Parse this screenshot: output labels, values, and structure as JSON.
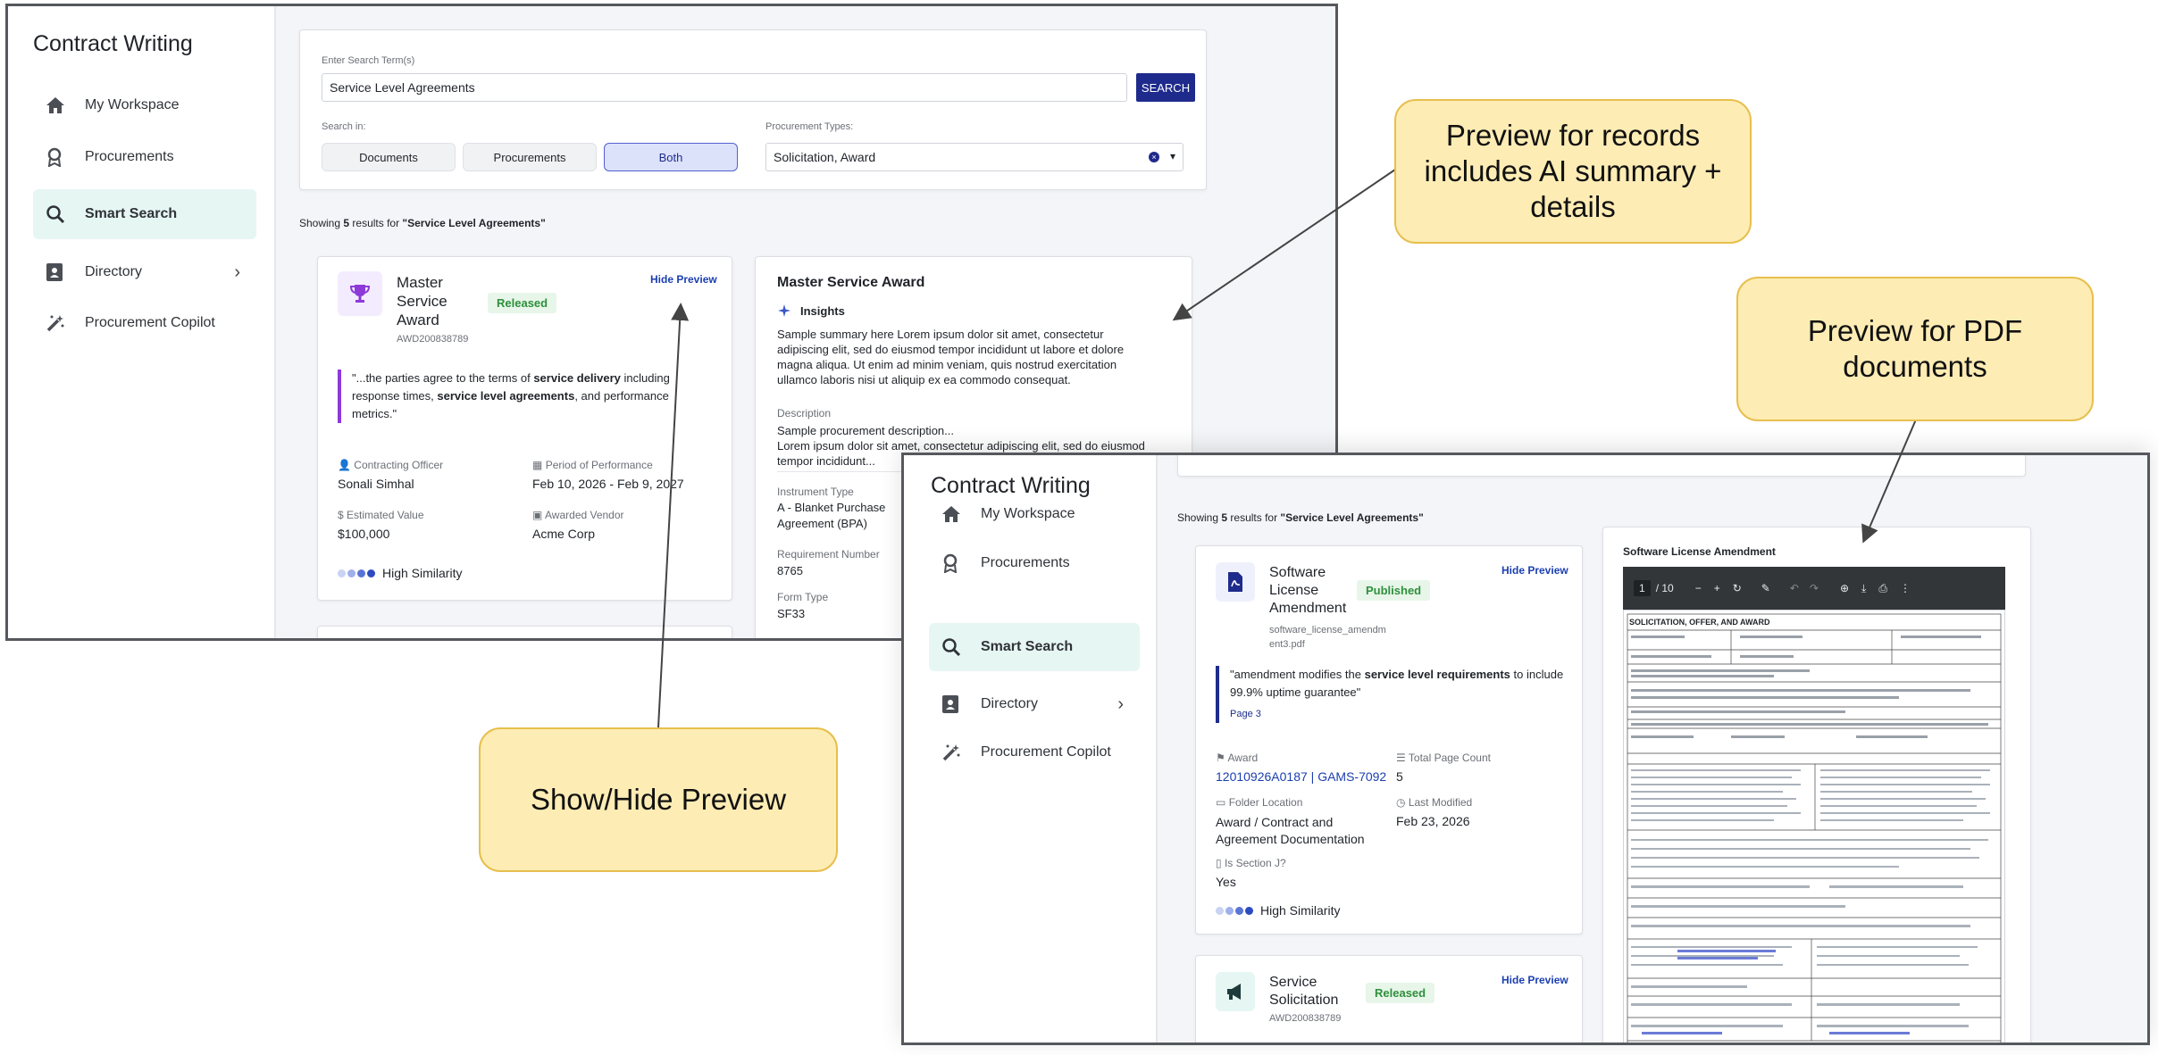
{
  "window1": {
    "app_title": "Contract Writing",
    "nav": [
      {
        "label": "My Workspace"
      },
      {
        "label": "Procurements"
      },
      {
        "label": "Smart Search"
      },
      {
        "label": "Directory"
      },
      {
        "label": "Procurement Copilot"
      }
    ],
    "search": {
      "label": "Enter Search Term(s)",
      "value": "Service Level Agreements",
      "button": "SEARCH",
      "search_in_label": "Search in:",
      "options": [
        "Documents",
        "Procurements",
        "Both"
      ],
      "selected_option": "Both",
      "types_label": "Procurement Types:",
      "types_value": "Solicitation, Award"
    },
    "results_prefix": "Showing ",
    "results_count": "5",
    "results_middle": " results for ",
    "results_query": "\"Service Level Agreements\"",
    "result_card": {
      "title_lines": [
        "Master",
        "Service",
        "Award"
      ],
      "status": "Released",
      "id": "AWD200838789",
      "hide_preview": "Hide Preview",
      "quote_1": "\"...the parties agree to the terms of ",
      "quote_b1": "service delivery",
      "quote_2": " including response times, ",
      "quote_b2": "service level agreements",
      "quote_3": ", and performance metrics.\"",
      "fields": [
        {
          "label": "Contracting Officer",
          "value": "Sonali Simhal"
        },
        {
          "label": "Period of Performance",
          "value": "Feb 10, 2026 - Feb 9, 2027"
        },
        {
          "label": "Estimated Value",
          "value": "$100,000"
        },
        {
          "label": "Awarded Vendor",
          "value": "Acme Corp"
        }
      ],
      "similarity": "High Similarity"
    },
    "preview": {
      "title": "Master Service Award",
      "insights_label": "Insights",
      "summary": "Sample summary here Lorem ipsum dolor sit amet, consectetur adipiscing elit, sed do eiusmod tempor incididunt ut labore et dolore magna aliqua. Ut enim ad minim veniam, quis nostrud exercitation ullamco laboris nisi ut aliquip ex ea commodo consequat.",
      "description_label": "Description",
      "description_line1": "Sample procurement description...",
      "description_line2": "Lorem ipsum dolor sit amet, consectetur adipiscing elit, sed do eiusmod tempor incididunt...",
      "instrument_label": "Instrument Type",
      "instrument_value": "A - Blanket Purchase Agreement (BPA)",
      "requirement_label": "Requirement Number",
      "requirement_value": "8765",
      "form_label": "Form Type",
      "form_value": "SF33"
    }
  },
  "window2": {
    "app_title": "Contract Writing",
    "nav": [
      {
        "label": "My Workspace"
      },
      {
        "label": "Procurements"
      },
      {
        "label": "Smart Search"
      },
      {
        "label": "Directory"
      },
      {
        "label": "Procurement Copilot"
      }
    ],
    "results_prefix": "Showing ",
    "results_count": "5",
    "results_middle": " results for ",
    "results_query": "\"Service Level Agreements\"",
    "doc_card": {
      "title_lines": [
        "Software",
        "License",
        "Amendment"
      ],
      "status": "Published",
      "filename_lines": [
        "software_license_amendm",
        "ent3.pdf"
      ],
      "hide_preview": "Hide Preview",
      "quote_1": "\"amendment modifies the ",
      "quote_b1": "service level requirements",
      "quote_2": " to include 99.9% uptime guarantee\"",
      "page": "Page 3",
      "award_label": "Award",
      "award_value": "12010926A0187 | GAMS-7092",
      "pages_label": "Total Page Count",
      "pages_value": "5",
      "folder_label": "Folder Location",
      "folder_value": "Award / Contract and Agreement Documentation",
      "modified_label": "Last Modified",
      "modified_value": "Feb 23, 2026",
      "section_label": "Is Section J?",
      "section_value": "Yes",
      "similarity": "High Similarity"
    },
    "second_card": {
      "title_lines": [
        "Service",
        "Solicitation"
      ],
      "status": "Released",
      "id": "AWD200838789",
      "hide_preview": "Hide Preview"
    },
    "pdf_preview": {
      "title": "Software License Amendment",
      "page_current": "1",
      "page_total": "/ 10",
      "doc_heading": "SOLICITATION, OFFER, AND AWARD"
    }
  },
  "callouts": {
    "records": "Preview for records includes AI summary + details",
    "pdf": "Preview for PDF documents",
    "toggle": "Show/Hide Preview"
  },
  "colors": {
    "accent_navy": "#1e2b8c",
    "smart_search_bg": "#e6f6f3",
    "callout_fill": "#fdecb4",
    "callout_border": "#e7bf4d",
    "released_green": "#2f8f3c",
    "quote_purple": "#8d3ad9"
  }
}
